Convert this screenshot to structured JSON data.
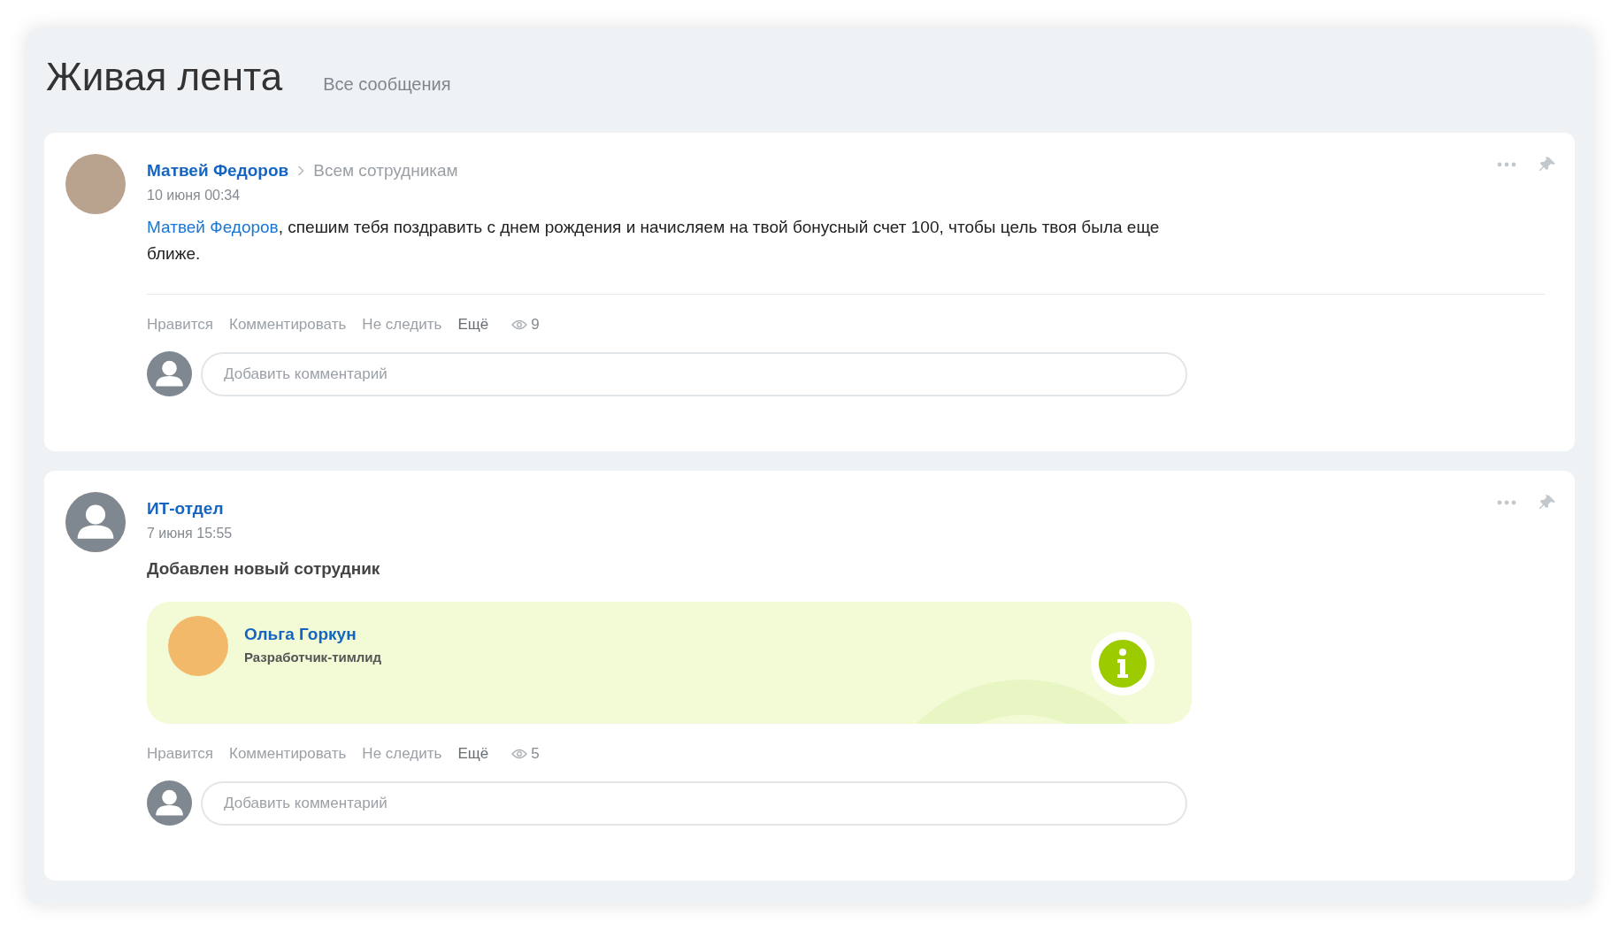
{
  "header": {
    "title": "Живая лента",
    "filter": "Все сообщения"
  },
  "posts": [
    {
      "kind": "message",
      "author": "Матвей Федоров",
      "recipient": "Всем сотрудникам",
      "date": "10 июня 00:34",
      "mention": "Матвей Федоров",
      "text": ", спешим тебя поздравить с днем рождения и начисляем на твой бонусный счет 100, чтобы цель твоя была еще ближе.",
      "actions": [
        "Нравится",
        "Комментировать",
        "Не следить",
        "Ещё"
      ],
      "views": "9",
      "comment_placeholder": "Добавить комментарий"
    },
    {
      "kind": "new_employee",
      "author": "ИТ-отдел",
      "date": "7 июня 15:55",
      "text": "Добавлен новый сотрудник",
      "employee": {
        "name": "Ольга Горкун",
        "role": "Разработчик-тимлид"
      },
      "actions": [
        "Нравится",
        "Комментировать",
        "Не следить",
        "Ещё"
      ],
      "views": "5",
      "comment_placeholder": "Добавить комментарий"
    }
  ]
}
